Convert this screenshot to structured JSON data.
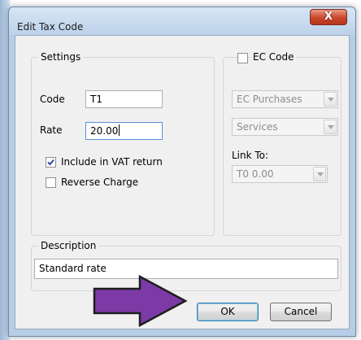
{
  "window": {
    "title": "Edit Tax Code",
    "close_glyph": "X"
  },
  "settings": {
    "group_label": "Settings",
    "code_label": "Code",
    "code_value": "T1",
    "rate_label": "Rate",
    "rate_value": "20.00",
    "include_vat_label": "Include in VAT return",
    "include_vat_checked": true,
    "reverse_charge_label": "Reverse Charge",
    "reverse_charge_checked": false
  },
  "ec": {
    "checkbox_label": "EC Code",
    "checked": false,
    "purchases_value": "EC Purchases",
    "services_value": "Services",
    "link_to_label": "Link To:",
    "link_to_value": "T0  0.00"
  },
  "description": {
    "group_label": "Description",
    "value": "Standard rate"
  },
  "buttons": {
    "ok_label": "OK",
    "cancel_label": "Cancel"
  },
  "colors": {
    "annotation_arrow_fill": "#7b3aa6",
    "annotation_arrow_stroke": "#1e1e1e",
    "close_button": "#c9472c"
  },
  "icons": {
    "checkmark": "checkmark-icon",
    "dropdown": "chevron-down-icon",
    "close": "close-icon",
    "annotation": "arrow-right-icon"
  }
}
